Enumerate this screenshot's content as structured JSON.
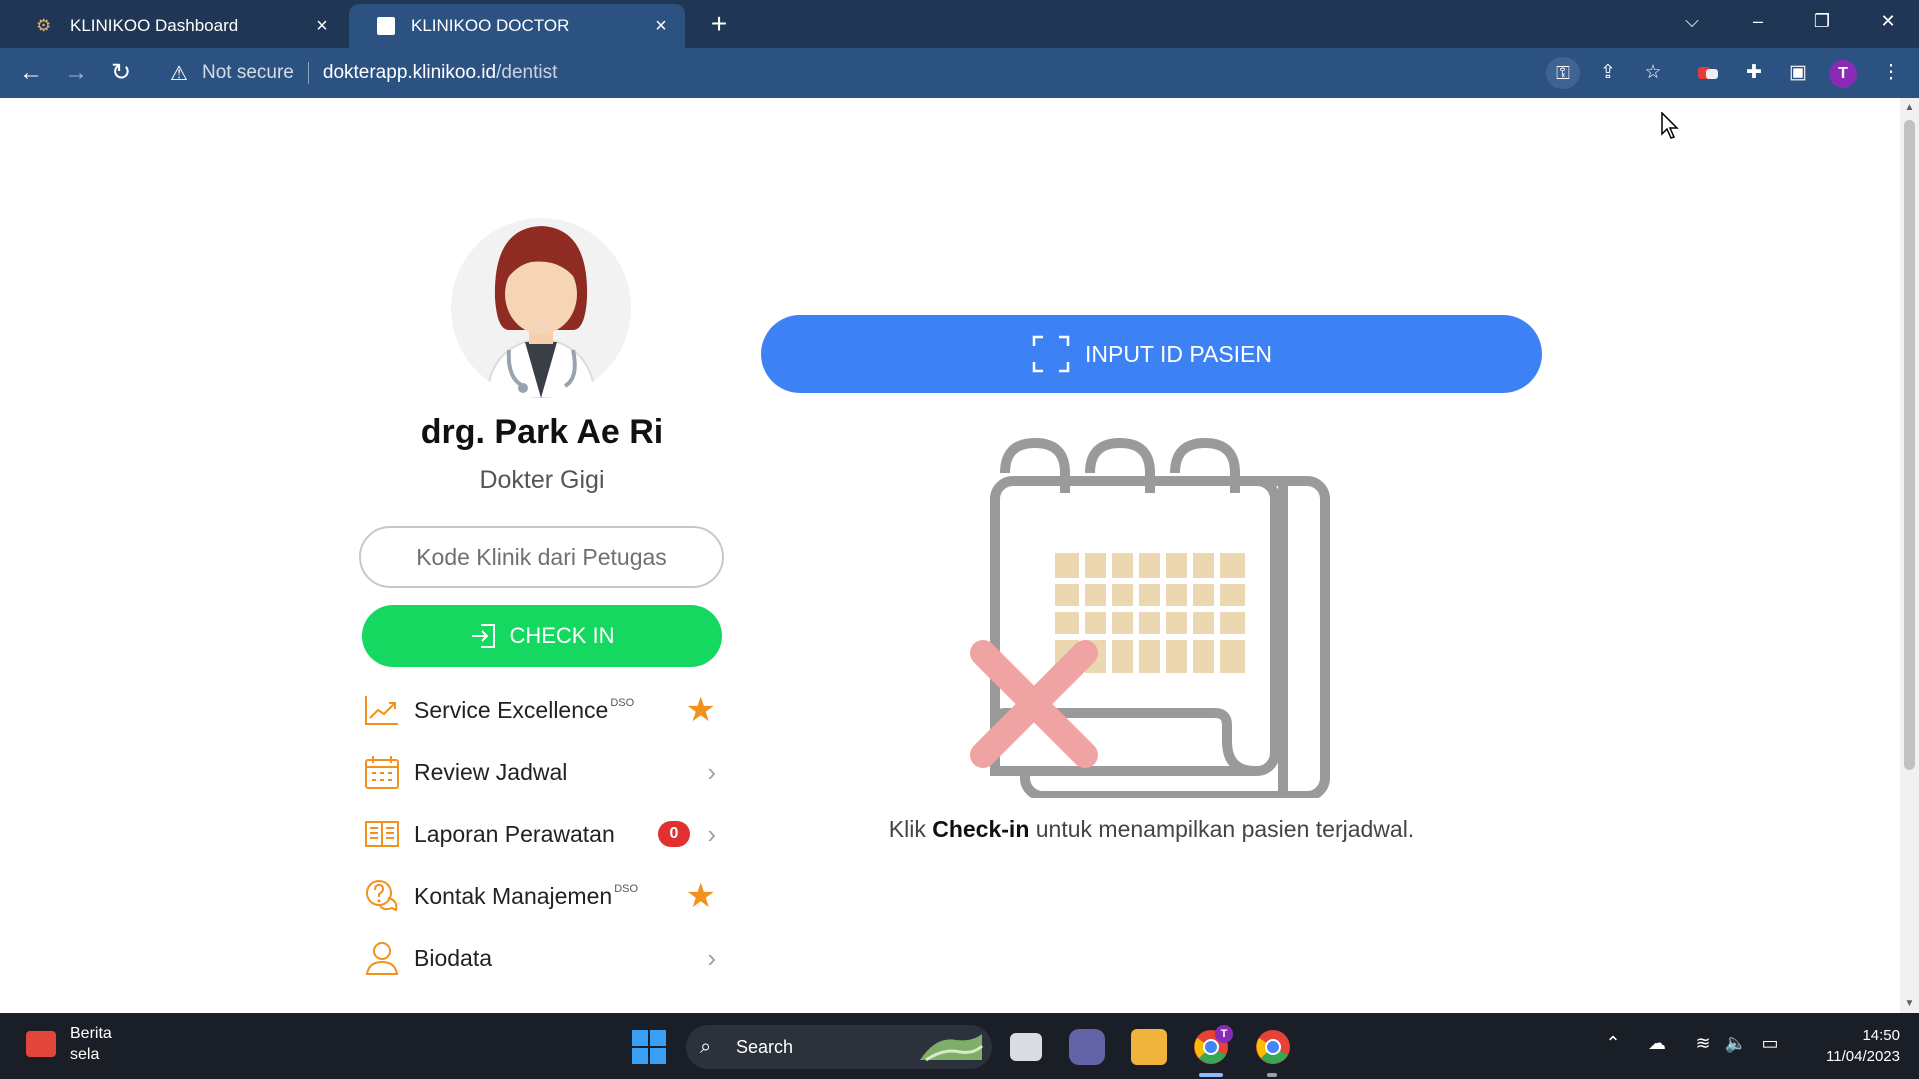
{
  "browser": {
    "tabs": [
      {
        "title": "KLINIKOO Dashboard",
        "active": false
      },
      {
        "title": "KLINIKOO DOCTOR",
        "active": true
      }
    ],
    "new_tab_label": "+",
    "address": {
      "security_label": "Not secure",
      "host": "dokterapp.klinikoo.id",
      "path": "/dentist"
    },
    "profile_initial": "T"
  },
  "profile": {
    "name": "drg. Park Ae Ri",
    "role": "Dokter Gigi",
    "clinic_code_placeholder": "Kode Klinik dari Petugas",
    "clinic_code_value": "",
    "checkin_label": "CHECK IN"
  },
  "menu": [
    {
      "label": "Service Excellence",
      "superscript": "DSO",
      "trailing": "star",
      "icon": "chart-icon"
    },
    {
      "label": "Review Jadwal",
      "superscript": "",
      "trailing": "chevron",
      "icon": "calendar-icon"
    },
    {
      "label": "Laporan Perawatan",
      "superscript": "",
      "trailing": "chevron",
      "badge": "0",
      "icon": "book-icon"
    },
    {
      "label": "Kontak Manajemen",
      "superscript": "DSO",
      "trailing": "star",
      "icon": "chat-question-icon"
    },
    {
      "label": "Biodata",
      "superscript": "",
      "trailing": "chevron",
      "icon": "user-icon"
    }
  ],
  "main": {
    "input_id_label": "INPUT ID PASIEN",
    "hint_prefix": "Klik ",
    "hint_bold": "Check-in",
    "hint_suffix": " untuk menampilkan pasien terjadwal."
  },
  "taskbar": {
    "news_title": "Berita",
    "news_subtitle": "sela",
    "search_label": "Search",
    "time": "14:50",
    "date": "11/04/2023",
    "chrome_badge": "T"
  },
  "colors": {
    "tab_bar": "#1f3654",
    "toolbar": "#2c5282",
    "checkin_green": "#14d860",
    "primary_blue": "#3d82f5",
    "accent_orange": "#f2911b",
    "badge_red": "#e03030"
  }
}
